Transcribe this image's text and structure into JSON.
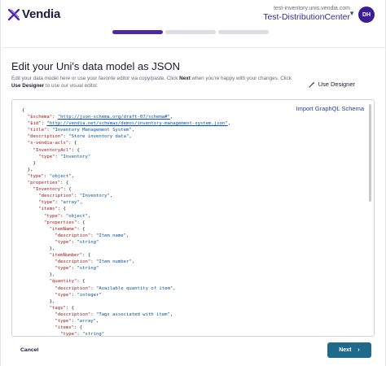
{
  "brand": {
    "name": "Vendia",
    "logo_icon": "vendia-x-icon"
  },
  "uni": {
    "url": "test-inventory.unis.vendia.com",
    "name": "Test-DistributionCenter"
  },
  "user": {
    "initials": "DH"
  },
  "progress": {
    "total_steps": 3,
    "current_step": 1
  },
  "page": {
    "title": "Edit your Uni's data model as JSON",
    "desc_part1": "Edit your data model here or use your favorite editor via copy/paste. Click ",
    "desc_next": "Next",
    "desc_part2": " when you're happy with your changes. Click ",
    "desc_designer": "Use Designer",
    "desc_part3": " to use our visual editor."
  },
  "actions": {
    "use_designer": "Use Designer",
    "import_graphql": "Import GraphQL Schema",
    "cancel": "Cancel",
    "next": "Next"
  },
  "colors": {
    "brand_purple": "#4b2aa8",
    "avatar": "#3c1e94",
    "next_button": "#1f6a8a",
    "link": "#2a3f9c"
  },
  "code_lines": [
    "{",
    "  \"$schema\": \"http://json-schema.org/draft-07/schema#\",",
    "  \"$id\": \"http://vendia.net/schemas/demos/inventory-management-system.json\",",
    "  \"title\": \"Inventory Management System\",",
    "  \"description\": \"Store inventory data\",",
    "  \"x-vendia-acls\": {",
    "    \"InventoryAcl\": {",
    "      \"type\": \"Inventory\"",
    "    }",
    "  },",
    "  \"type\": \"object\",",
    "  \"properties\": {",
    "    \"Inventory\": {",
    "      \"description\": \"Inventory\",",
    "      \"type\": \"array\",",
    "      \"items\": {",
    "        \"type\": \"object\",",
    "        \"properties\": {",
    "          \"itemName\": {",
    "            \"description\": \"Item name\",",
    "            \"type\": \"string\"",
    "          },",
    "          \"itemNumber\": {",
    "            \"description\": \"Item number\",",
    "            \"type\": \"string\"",
    "          },",
    "          \"quantity\": {",
    "            \"description\": \"Available quantity of item\",",
    "            \"type\": \"integer\"",
    "          },",
    "          \"tags\": {",
    "            \"description\": \"Tags associated with item\",",
    "            \"type\": \"array\",",
    "            \"items\": {",
    "              \"type\": \"string\""
  ]
}
